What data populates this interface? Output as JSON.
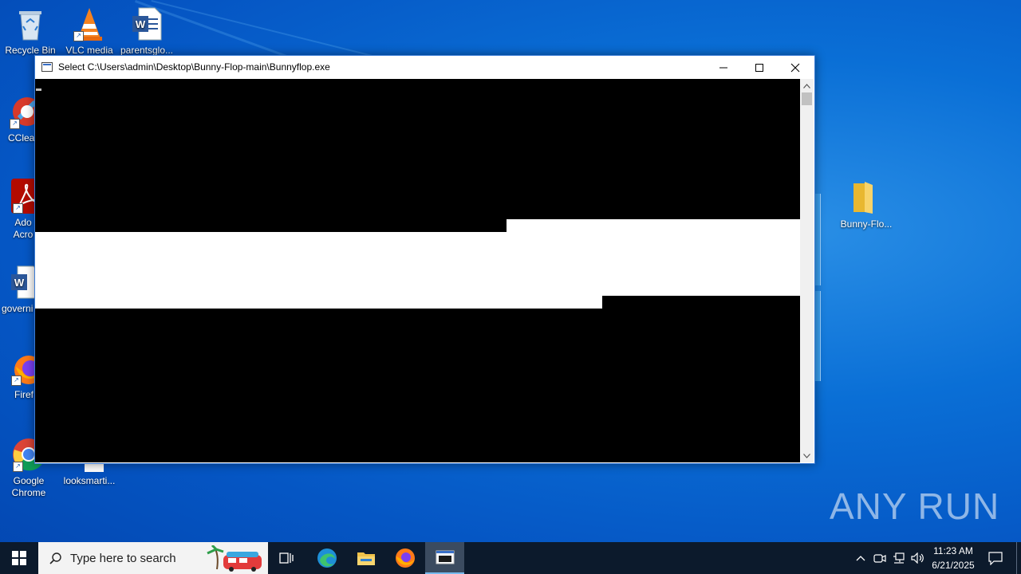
{
  "desktop": {
    "icons": [
      {
        "label": "Recycle Bin",
        "icon": "recycle-bin-icon"
      },
      {
        "label": "VLC media",
        "icon": "vlc-icon"
      },
      {
        "label": "parentsglo...",
        "icon": "word-document-icon"
      },
      {
        "label": "CClea",
        "icon": "ccleaner-icon"
      },
      {
        "label": "Ado Acro",
        "icon": "adobe-acrobat-icon"
      },
      {
        "label": "governi",
        "icon": "word-document-icon"
      },
      {
        "label": "Firef",
        "icon": "firefox-icon"
      },
      {
        "label": "Google Chrome",
        "icon": "chrome-icon"
      },
      {
        "label": "looksmarti...",
        "icon": "document-icon"
      },
      {
        "label": "Bunny-Flo...",
        "icon": "folder-icon"
      }
    ]
  },
  "window": {
    "title": "Select C:\\Users\\admin\\Desktop\\Bunny-Flop-main\\Bunnyflop.exe",
    "minimize_icon": "minimize-icon",
    "maximize_icon": "maximize-icon",
    "close_icon": "close-icon"
  },
  "taskbar": {
    "search_placeholder": "Type here to search",
    "clock_time": "11:23 AM",
    "clock_date": "6/21/2025",
    "pinned": [
      "task-view-icon",
      "edge-icon",
      "file-explorer-icon",
      "firefox-icon",
      "console-icon"
    ]
  },
  "watermark": {
    "text": "ANY RUN"
  }
}
